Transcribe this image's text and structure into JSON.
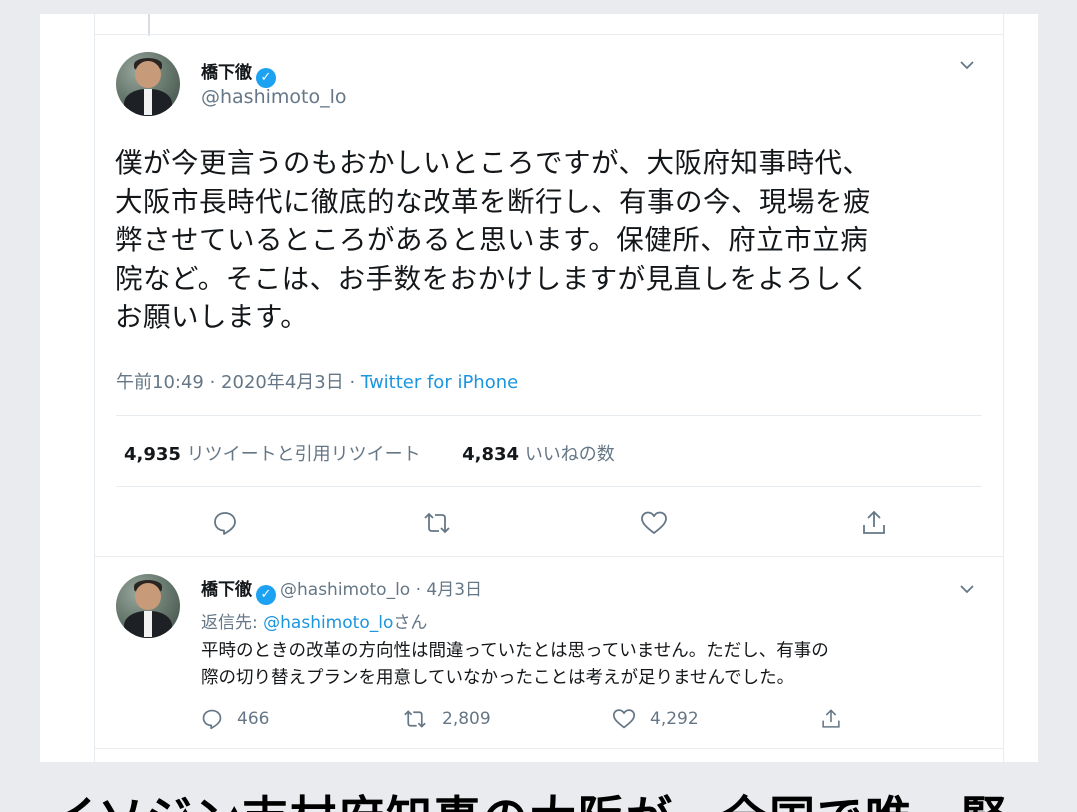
{
  "tweet": {
    "author_name": "橋下徹",
    "author_handle": "@hashimoto_lo",
    "text_lines": [
      "僕が今更言うのもおかしいところですが、大阪府知事時代、",
      "大阪市長時代に徹底的な改革を断行し、有事の今、現場を疲",
      "弊させているところがあると思います。保健所、府立市立病",
      "院など。そこは、お手数をおかけしますが見直しをよろしく",
      "お願いします。"
    ],
    "timestamp": "午前10:49 · 2020年4月3日 · ",
    "source": "Twitter for iPhone",
    "retweet_count": "4,935",
    "retweet_label": "リツイートと引用リツイート",
    "like_count": "4,834",
    "like_label": "いいねの数"
  },
  "reply": {
    "author_name": "橋下徹",
    "handle_date": "@hashimoto_lo · 4月3日",
    "reply_prefix": "返信先: ",
    "reply_mention": "@hashimoto_lo",
    "reply_suffix": "さん",
    "text_lines": [
      "平時のときの改革の方向性は間違っていたとは思っていません。ただし、有事の",
      "際の切り替えプランを用意していなかったことは考えが足りませんでした。"
    ],
    "reply_count": "466",
    "retweet_count": "2,809",
    "like_count": "4,292"
  },
  "icons": {
    "verified": "verified-check-icon",
    "chevron": "chevron-down-icon",
    "reply": "reply-bubble-icon",
    "retweet": "retweet-arrows-icon",
    "like": "heart-icon",
    "share": "share-upload-icon"
  },
  "colors": {
    "accent": "#1da1f2",
    "link": "#1b95e0",
    "muted": "#657786",
    "page_bg": "#e9ebee"
  },
  "caption": "イソジン吉村府知事の大阪が、全国で唯一緊"
}
